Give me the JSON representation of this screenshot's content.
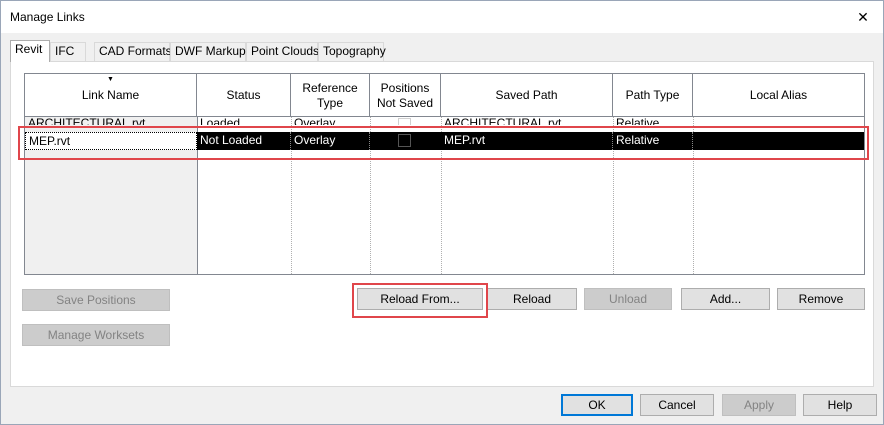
{
  "window": {
    "title": "Manage Links",
    "close_glyph": "✕"
  },
  "tabs": [
    {
      "label": "Revit",
      "active": true
    },
    {
      "label": "IFC"
    },
    {
      "label": "CAD Formats"
    },
    {
      "label": "DWF Markups"
    },
    {
      "label": "Point Clouds"
    },
    {
      "label": "Topography"
    }
  ],
  "grid": {
    "columns": [
      "Link Name",
      "Status",
      "Reference\nType",
      "Positions\nNot Saved",
      "Saved Path",
      "Path Type",
      "Local Alias"
    ],
    "sort_glyph": "▼",
    "rows": [
      {
        "name": "ARCHITECTURAL.rvt",
        "status": "Loaded",
        "ref_type": "Overlay",
        "positions_not_saved": false,
        "saved_path": "ARCHITECTURAL.rvt",
        "path_type": "Relative",
        "local_alias": ""
      },
      {
        "name": "MEP.rvt",
        "status": "Not Loaded",
        "ref_type": "Overlay",
        "positions_not_saved": false,
        "saved_path": "MEP.rvt",
        "path_type": "Relative",
        "local_alias": "",
        "selected": true
      }
    ]
  },
  "buttons": {
    "save_positions": "Save Positions",
    "manage_worksets": "Manage Worksets",
    "reload_from": "Reload From...",
    "reload": "Reload",
    "unload": "Unload",
    "add": "Add...",
    "remove": "Remove",
    "ok": "OK",
    "cancel": "Cancel",
    "apply": "Apply",
    "help": "Help"
  },
  "colors": {
    "highlight": "#e0464b",
    "selection": "#000000",
    "default_button_border": "#0078d7"
  }
}
